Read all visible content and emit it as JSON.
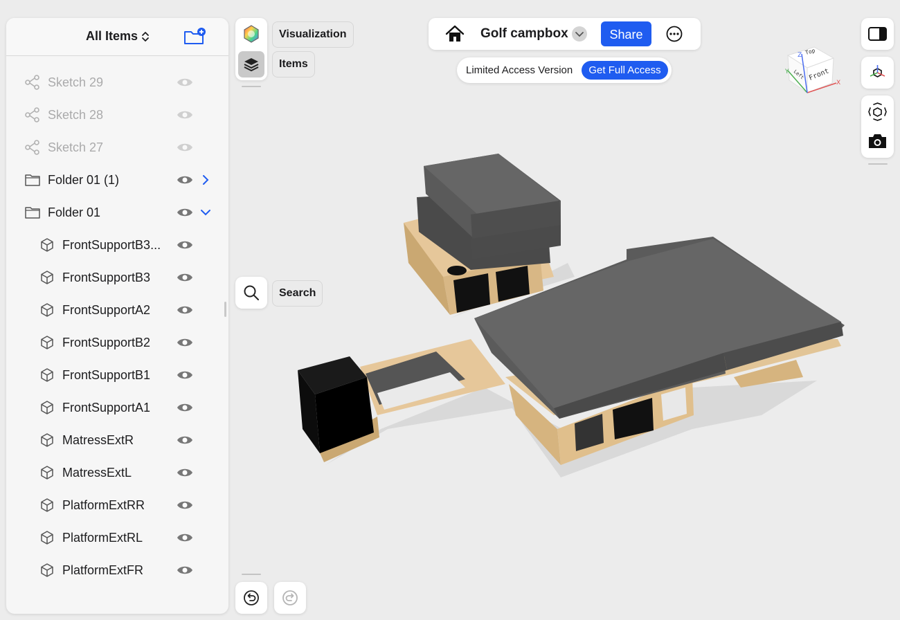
{
  "sidebar": {
    "title": "All Items",
    "items": [
      {
        "label": "Sketch 29",
        "type": "sketch",
        "dim": true
      },
      {
        "label": "Sketch 28",
        "type": "sketch",
        "dim": true
      },
      {
        "label": "Sketch 27",
        "type": "sketch",
        "dim": true
      },
      {
        "label": "Folder 01 (1)",
        "type": "folder",
        "expanded": false
      },
      {
        "label": "Folder 01",
        "type": "folder",
        "expanded": true
      },
      {
        "label": "FrontSupportB3...",
        "type": "body"
      },
      {
        "label": "FrontSupportB3",
        "type": "body"
      },
      {
        "label": "FrontSupportA2",
        "type": "body"
      },
      {
        "label": "FrontSupportB2",
        "type": "body"
      },
      {
        "label": "FrontSupportB1",
        "type": "body"
      },
      {
        "label": "FrontSupportA1",
        "type": "body"
      },
      {
        "label": "MatressExtR",
        "type": "body"
      },
      {
        "label": "MatressExtL",
        "type": "body"
      },
      {
        "label": "PlatformExtRR",
        "type": "body"
      },
      {
        "label": "PlatformExtRL",
        "type": "body"
      },
      {
        "label": "PlatformExtFR",
        "type": "body"
      }
    ]
  },
  "tools": {
    "visualization_label": "Visualization",
    "items_label": "Items",
    "search_label": "Search"
  },
  "topbar": {
    "project_title": "Golf campbox",
    "share_label": "Share"
  },
  "access": {
    "limited_text": "Limited Access Version",
    "full_access_label": "Get Full Access"
  },
  "viewcube": {
    "top": "Top",
    "front": "Front",
    "left": "Left",
    "axis_x": "X",
    "axis_y": "Y",
    "axis_z": "Z"
  },
  "colors": {
    "accent": "#1f5cf0",
    "wood": "#e2c597",
    "cushion": "#555555"
  }
}
